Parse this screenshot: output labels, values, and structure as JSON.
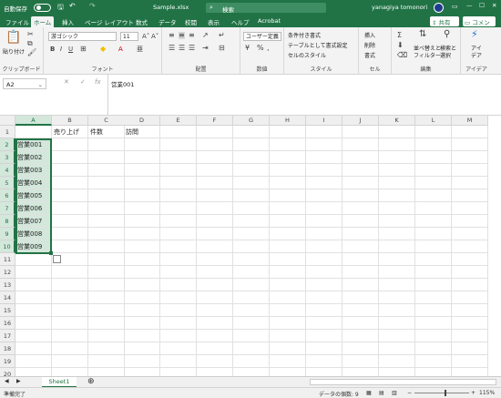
{
  "titlebar": {
    "autosave_label": "自動保存",
    "autosave_state": "オフ",
    "filename": "Sample.xlsx",
    "search_placeholder": "検索",
    "user": "yanagiya tomonori"
  },
  "menu": {
    "items": [
      "ファイル",
      "ホーム",
      "挿入",
      "ページ レイアウト",
      "数式",
      "データ",
      "校閲",
      "表示",
      "ヘルプ",
      "Acrobat"
    ],
    "active": "ホーム",
    "share_label": "共有",
    "comment_label": "コメント"
  },
  "ribbon": {
    "clipboard": {
      "label": "クリップボード",
      "paste": "貼り付け"
    },
    "font": {
      "label": "フォント",
      "name": "游ゴシック",
      "size": "11"
    },
    "alignment": {
      "label": "配置"
    },
    "number": {
      "label": "数値",
      "format": "ユーザー定義"
    },
    "styles": {
      "label": "スタイル",
      "cond": "条件付き書式",
      "table": "テーブルとして書式設定",
      "cell": "セルのスタイル"
    },
    "cells": {
      "label": "セル",
      "insert": "挿入",
      "delete": "削除",
      "format": "書式"
    },
    "editing": {
      "label": "編集",
      "sort": "並べ替えと",
      "sort2": "フィルター",
      "find": "検索と",
      "find2": "選択"
    },
    "ideas": {
      "label": "アイデア",
      "btn": "アイ",
      "btn2": "デア"
    }
  },
  "formula_bar": {
    "name_box": "A2",
    "content": "営業001"
  },
  "columns": [
    "A",
    "B",
    "C",
    "D",
    "E",
    "F",
    "G",
    "H",
    "I",
    "J",
    "K",
    "L",
    "M"
  ],
  "rows": [
    "1",
    "2",
    "3",
    "4",
    "5",
    "6",
    "7",
    "8",
    "9",
    "10",
    "11",
    "12",
    "13",
    "14",
    "15",
    "16",
    "17",
    "18",
    "19",
    "20"
  ],
  "cells": {
    "B1": "売り上げ",
    "C1": "件数",
    "D1": "訪問",
    "A2": "営業001",
    "A3": "営業002",
    "A4": "営業003",
    "A5": "営業004",
    "A6": "営業005",
    "A7": "営業006",
    "A8": "営業007",
    "A9": "営業008",
    "A10": "営業009"
  },
  "sheet_tabs": [
    "Sheet1"
  ],
  "status": {
    "ready": "準備完了",
    "count": "データの個数: 9",
    "zoom": "115%"
  },
  "colors": {
    "accent": "#217346",
    "selection": "#d3e7db"
  }
}
